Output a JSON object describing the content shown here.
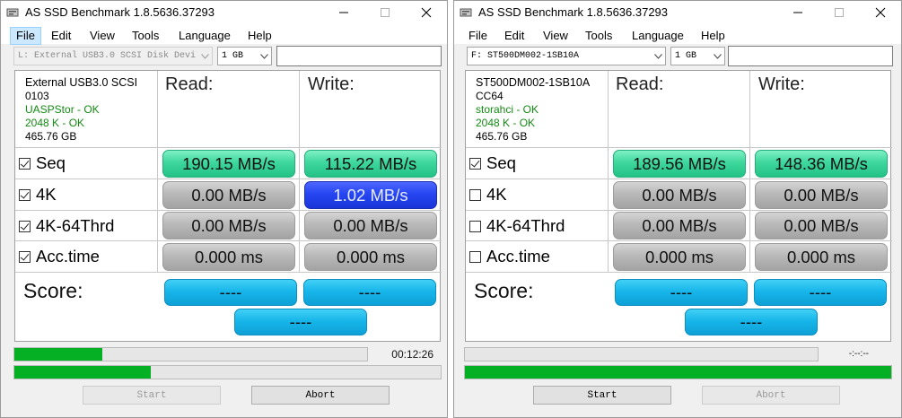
{
  "colors": {
    "accent_green": "#3ed79d",
    "accent_blue": "#2646f2",
    "score_cyan": "#17b6ea",
    "status_ok": "#138a13",
    "progress_green": "#06b025"
  },
  "windows": [
    {
      "title": "AS SSD Benchmark 1.8.5636.37293",
      "menu": [
        "File",
        "Edit",
        "View",
        "Tools",
        "Language",
        "Help"
      ],
      "drive_select": "L: External USB3.0 SCSI Disk Devi",
      "size_select": "1 GB",
      "info": {
        "name": "External USB3.0 SCSI",
        "firmware": "0103",
        "driver": "UASPStor - OK",
        "alignment": "2048 K - OK",
        "capacity": "465.76 GB"
      },
      "read_label": "Read:",
      "write_label": "Write:",
      "rows": [
        {
          "label": "Seq",
          "checked": true,
          "read": "190.15 MB/s",
          "write": "115.22 MB/s"
        },
        {
          "label": "4K",
          "checked": true,
          "read": "0.00 MB/s",
          "write": "1.02 MB/s"
        },
        {
          "label": "4K-64Thrd",
          "checked": true,
          "read": "0.00 MB/s",
          "write": "0.00 MB/s"
        },
        {
          "label": "Acc.time",
          "checked": true,
          "read": "0.000 ms",
          "write": "0.000 ms"
        }
      ],
      "score_label": "Score:",
      "score_read": "----",
      "score_write": "----",
      "score_total": "----",
      "progress_top": 0.25,
      "progress_bottom": 0.32,
      "elapsed": "00:12:26",
      "start_label": "Start",
      "abort_label": "Abort"
    },
    {
      "title": "AS SSD Benchmark 1.8.5636.37293",
      "menu": [
        "File",
        "Edit",
        "View",
        "Tools",
        "Language",
        "Help"
      ],
      "drive_select": "F: ST500DM002-1SB10A",
      "size_select": "1 GB",
      "info": {
        "name": "ST500DM002-1SB10A",
        "firmware": "CC64",
        "driver": "storahci - OK",
        "alignment": "2048 K - OK",
        "capacity": "465.76 GB"
      },
      "read_label": "Read:",
      "write_label": "Write:",
      "rows": [
        {
          "label": "Seq",
          "checked": true,
          "read": "189.56 MB/s",
          "write": "148.36 MB/s"
        },
        {
          "label": "4K",
          "checked": false,
          "read": "0.00 MB/s",
          "write": "0.00 MB/s"
        },
        {
          "label": "4K-64Thrd",
          "checked": false,
          "read": "0.00 MB/s",
          "write": "0.00 MB/s"
        },
        {
          "label": "Acc.time",
          "checked": false,
          "read": "0.000 ms",
          "write": "0.000 ms"
        }
      ],
      "score_label": "Score:",
      "score_read": "----",
      "score_write": "----",
      "score_total": "----",
      "progress_top": 0.0,
      "progress_bottom": 1.0,
      "elapsed": "-:--:--",
      "start_label": "Start",
      "abort_label": "Abort"
    }
  ]
}
